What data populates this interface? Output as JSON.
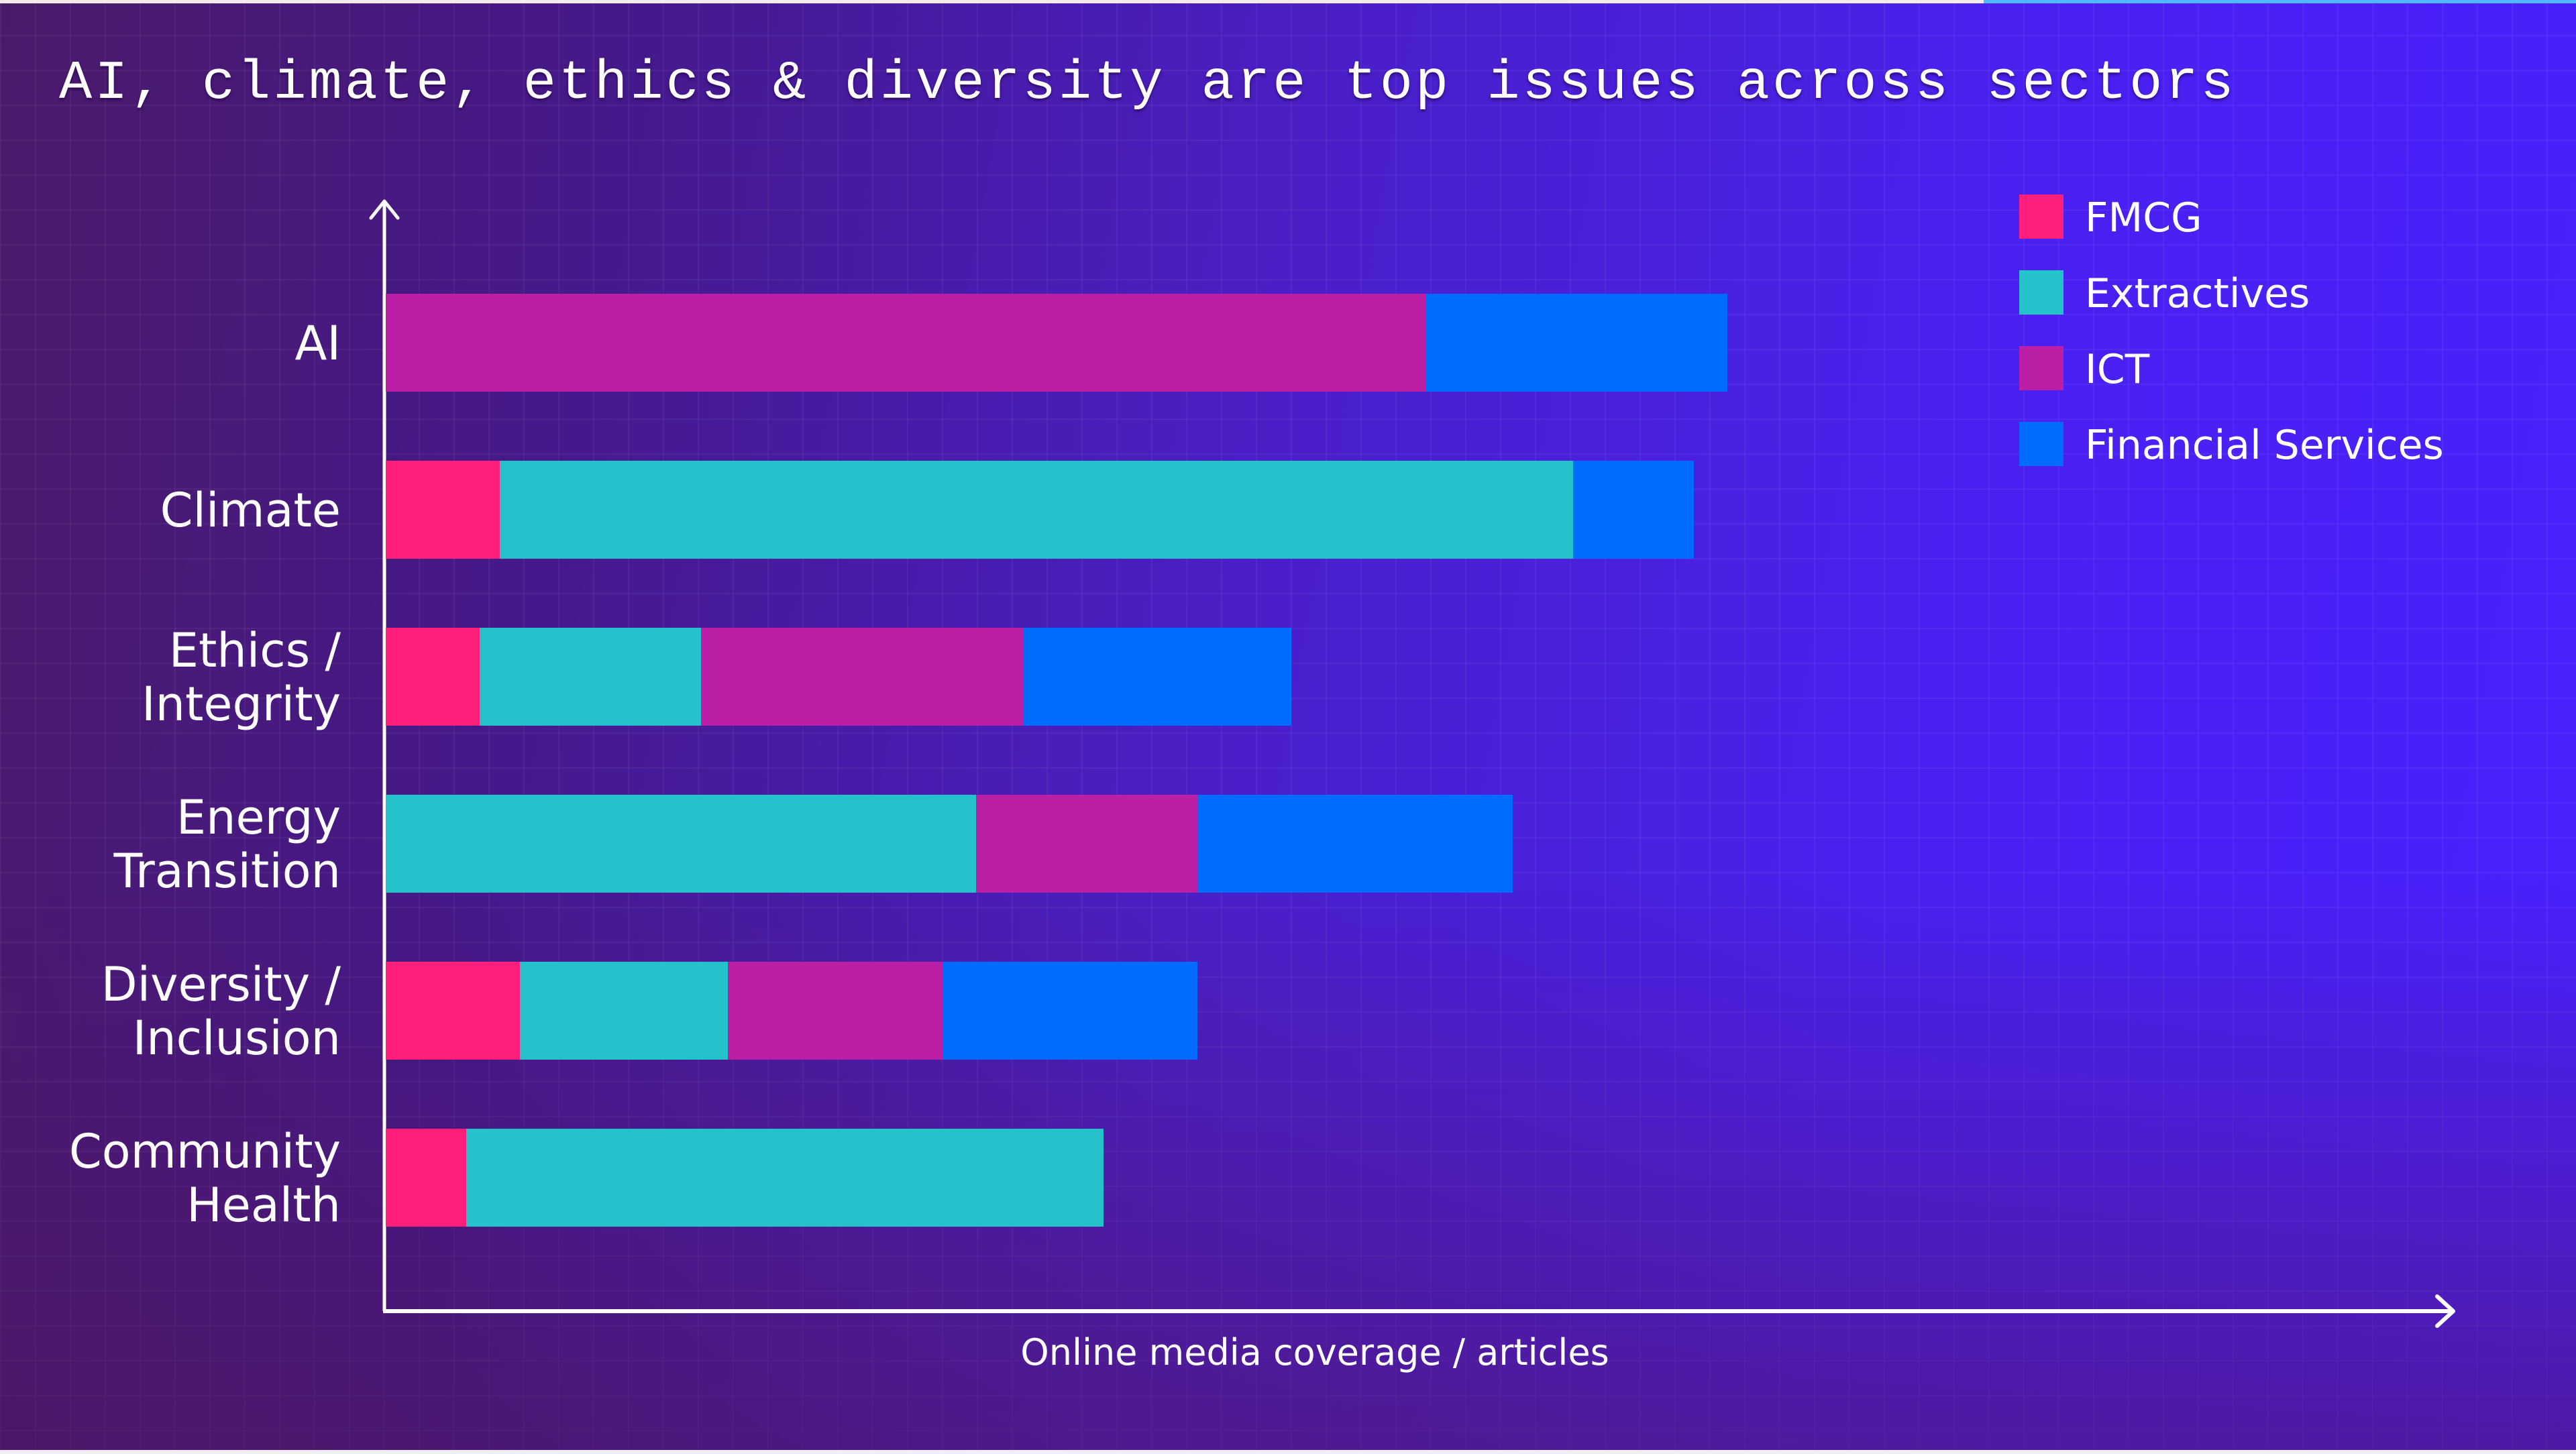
{
  "slide": {
    "title": "AI, climate, ethics & diversity are top issues across sectors",
    "playback_progress_percent": 77
  },
  "colors": {
    "FMCG": "#ff1f7a",
    "Extractives": "#26c2cc",
    "ICT": "#bb1fa6",
    "Financial Services": "#006bff",
    "axis": "#ffffff",
    "text": "#ffffff"
  },
  "chart_data": {
    "type": "bar",
    "orientation": "horizontal",
    "stacked": true,
    "title": "AI, climate, ethics & diversity are top issues across sectors",
    "xlabel": "Online media coverage / articles",
    "ylabel": "",
    "x_ticks": "none (relative scale, values estimated in arbitrary units)",
    "xlim": [
      0,
      270
    ],
    "grid": false,
    "legend_position": "top-right",
    "categories": [
      [
        "AI"
      ],
      [
        "Climate"
      ],
      [
        "Ethics /",
        "Integrity"
      ],
      [
        "Energy",
        "Transition"
      ],
      [
        "Diversity /",
        "Inclusion"
      ],
      [
        "Community",
        "Health"
      ]
    ],
    "series": [
      {
        "name": "FMCG",
        "values": [
          0,
          17,
          14,
          0,
          20,
          12
        ]
      },
      {
        "name": "Extractives",
        "values": [
          0,
          160,
          33,
          88,
          31,
          95
        ]
      },
      {
        "name": "ICT",
        "values": [
          155,
          0,
          48,
          33,
          32,
          0
        ]
      },
      {
        "name": "Financial Services",
        "values": [
          45,
          18,
          40,
          47,
          38,
          0
        ]
      }
    ]
  }
}
